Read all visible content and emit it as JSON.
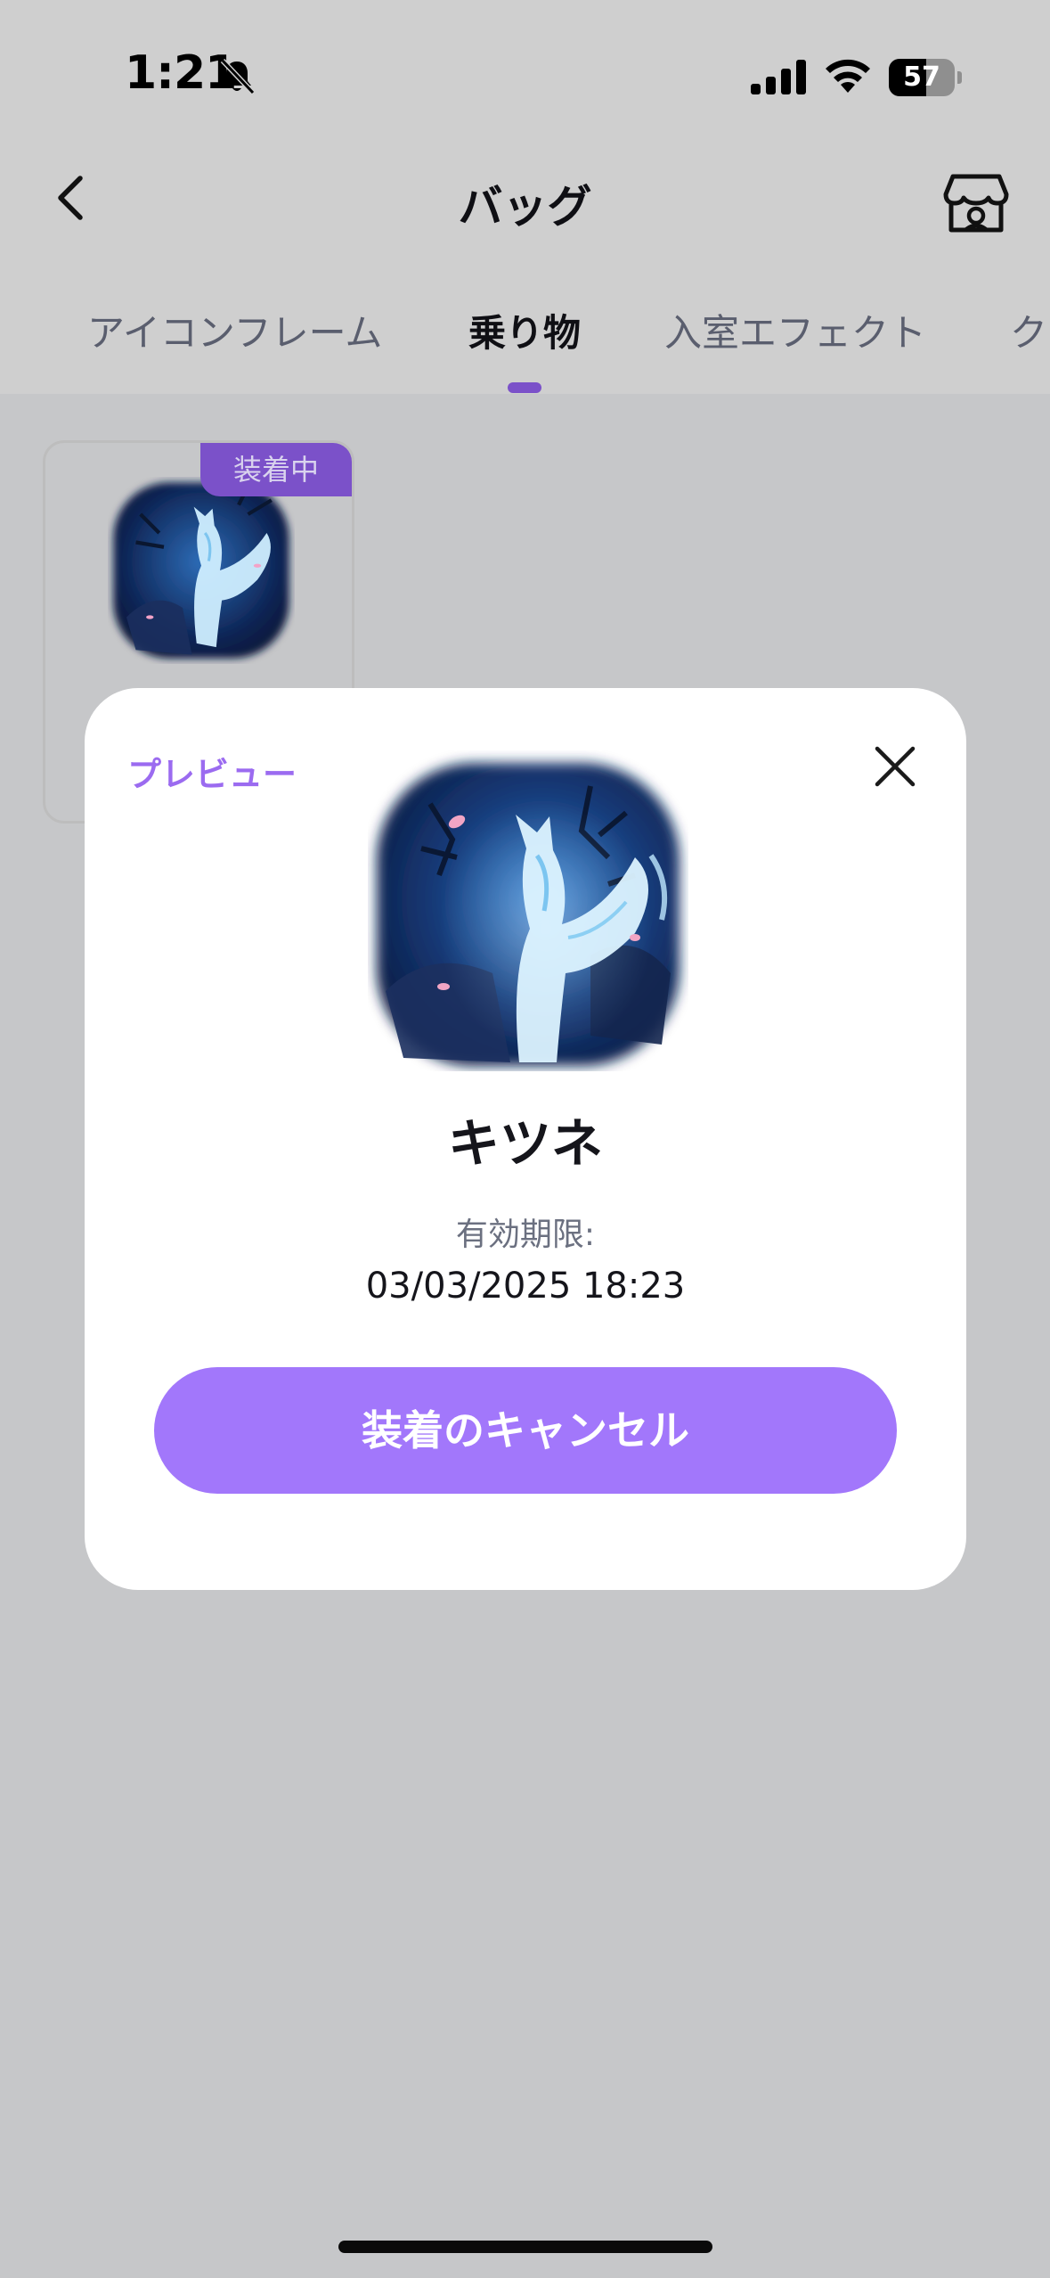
{
  "status_bar": {
    "time": "1:21",
    "battery": "57",
    "battery_level": 0.57
  },
  "nav": {
    "title": "バッグ",
    "back_icon": "chevron-left-icon",
    "store_icon": "store-icon"
  },
  "tabs": [
    {
      "label": "アイコンフレーム",
      "active": false
    },
    {
      "label": "乗り物",
      "active": true
    },
    {
      "label": "入室エフェクト",
      "active": false
    },
    {
      "label": "ク",
      "active": false
    }
  ],
  "item_card": {
    "badge": "装着中",
    "image": "fox-spirit-thumbnail"
  },
  "modal": {
    "preview_label": "プレビュー",
    "close_icon": "close-icon",
    "image": "fox-spirit-image",
    "name": "キツネ",
    "expiry_label": "有効期限:",
    "expiry_value": "03/03/2025 18:23",
    "button_label": "装着のキャンセル"
  },
  "colors": {
    "accent": "#a277fb",
    "accent_dark": "#7b51c9",
    "background": "#c6c7c9"
  }
}
